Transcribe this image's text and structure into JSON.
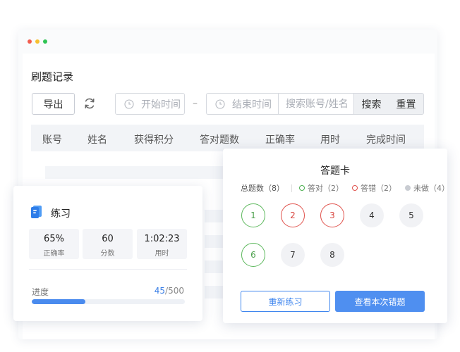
{
  "records": {
    "title": "刷题记录",
    "toolbar": {
      "export_label": "导出",
      "start_placeholder": "开始时间",
      "range_sep": "–",
      "end_placeholder": "结束时间",
      "search_placeholder": "搜索账号/姓名",
      "search_label": "搜索",
      "reset_label": "重置"
    },
    "columns": [
      "账号",
      "姓名",
      "获得积分",
      "答对题数",
      "正确率",
      "用时",
      "完成时间"
    ]
  },
  "practice": {
    "title": "练习",
    "stats": [
      {
        "value": "65%",
        "label": "正确率"
      },
      {
        "value": "60",
        "label": "分数"
      },
      {
        "value": "1:02:23",
        "label": "用时"
      }
    ],
    "progress": {
      "label": "进度",
      "current": "45",
      "total": "/500",
      "fraction": 0.35
    }
  },
  "answer_card": {
    "title": "答题卡",
    "summary": "总题数（8）",
    "legend": {
      "correct": "答对（2）",
      "wrong": "答错（2）",
      "undone": "未做（4）"
    },
    "questions": [
      {
        "num": "1",
        "status": "correct"
      },
      {
        "num": "2",
        "status": "wrong"
      },
      {
        "num": "3",
        "status": "wrong"
      },
      {
        "num": "4",
        "status": "undone"
      },
      {
        "num": "5",
        "status": "undone"
      },
      {
        "num": "6",
        "status": "correct"
      },
      {
        "num": "7",
        "status": "undone"
      },
      {
        "num": "8",
        "status": "undone"
      }
    ],
    "retry_label": "重新练习",
    "view_wrong_label": "查看本次错题"
  },
  "colors": {
    "accent": "#4f8ff0",
    "correct": "#5cb85c",
    "wrong": "#e0524c",
    "undone": "#c9ccd2"
  }
}
